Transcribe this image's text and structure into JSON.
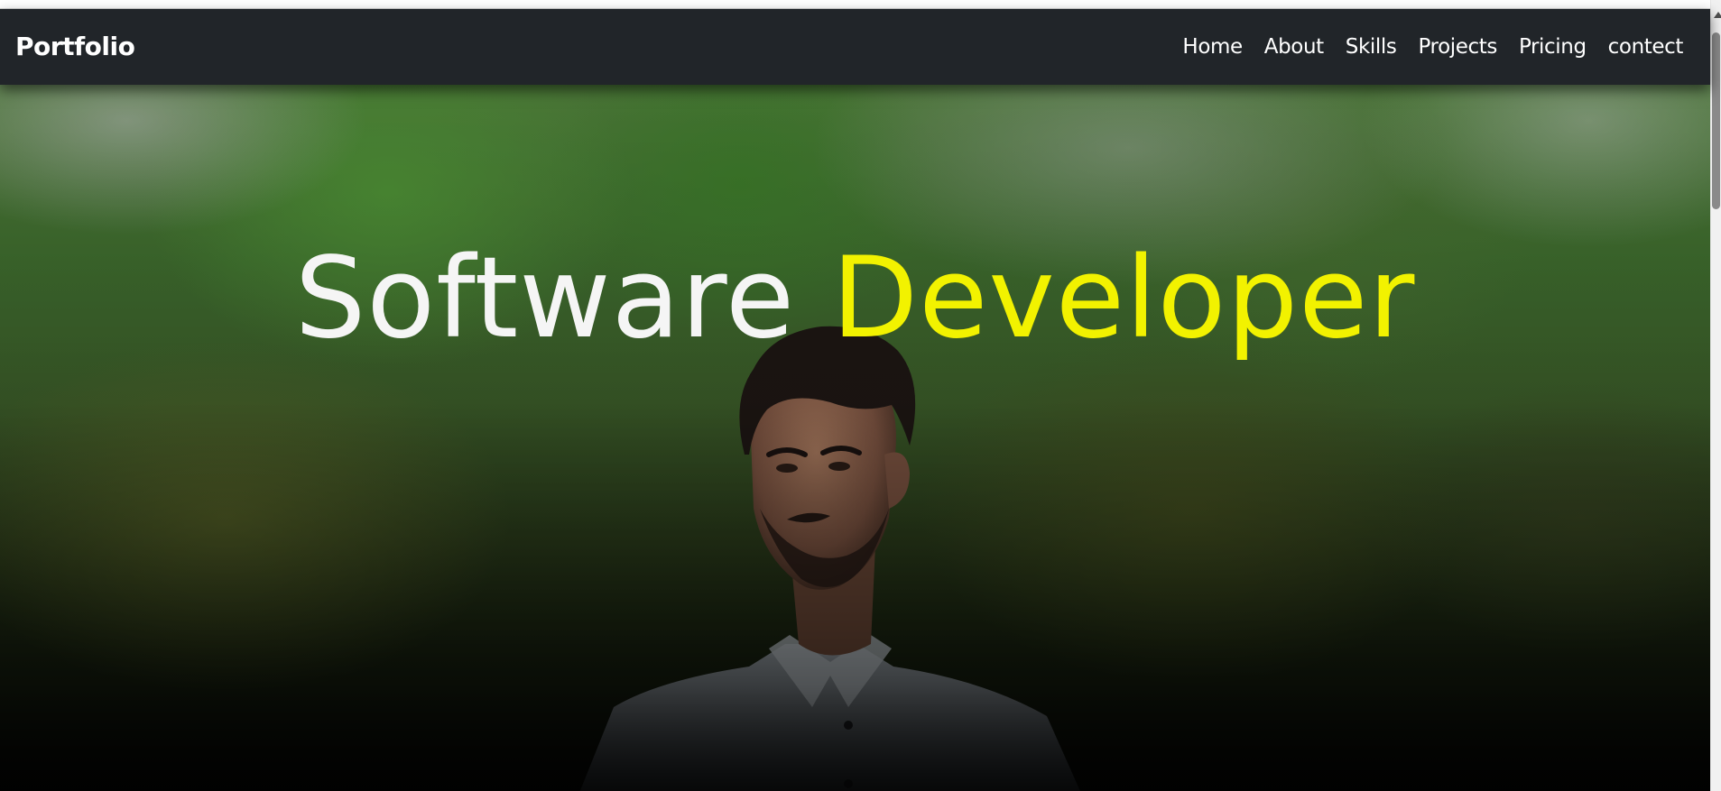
{
  "navbar": {
    "brand": "Portfolio",
    "links": [
      "Home",
      "About",
      "Skills",
      "Projects",
      "Pricing",
      "contect"
    ],
    "background": "#212529"
  },
  "hero": {
    "title_part1": "Software",
    "title_part2": "Developer",
    "title_part1_color": "#f5f5f5",
    "title_part2_color": "#f2f200"
  }
}
